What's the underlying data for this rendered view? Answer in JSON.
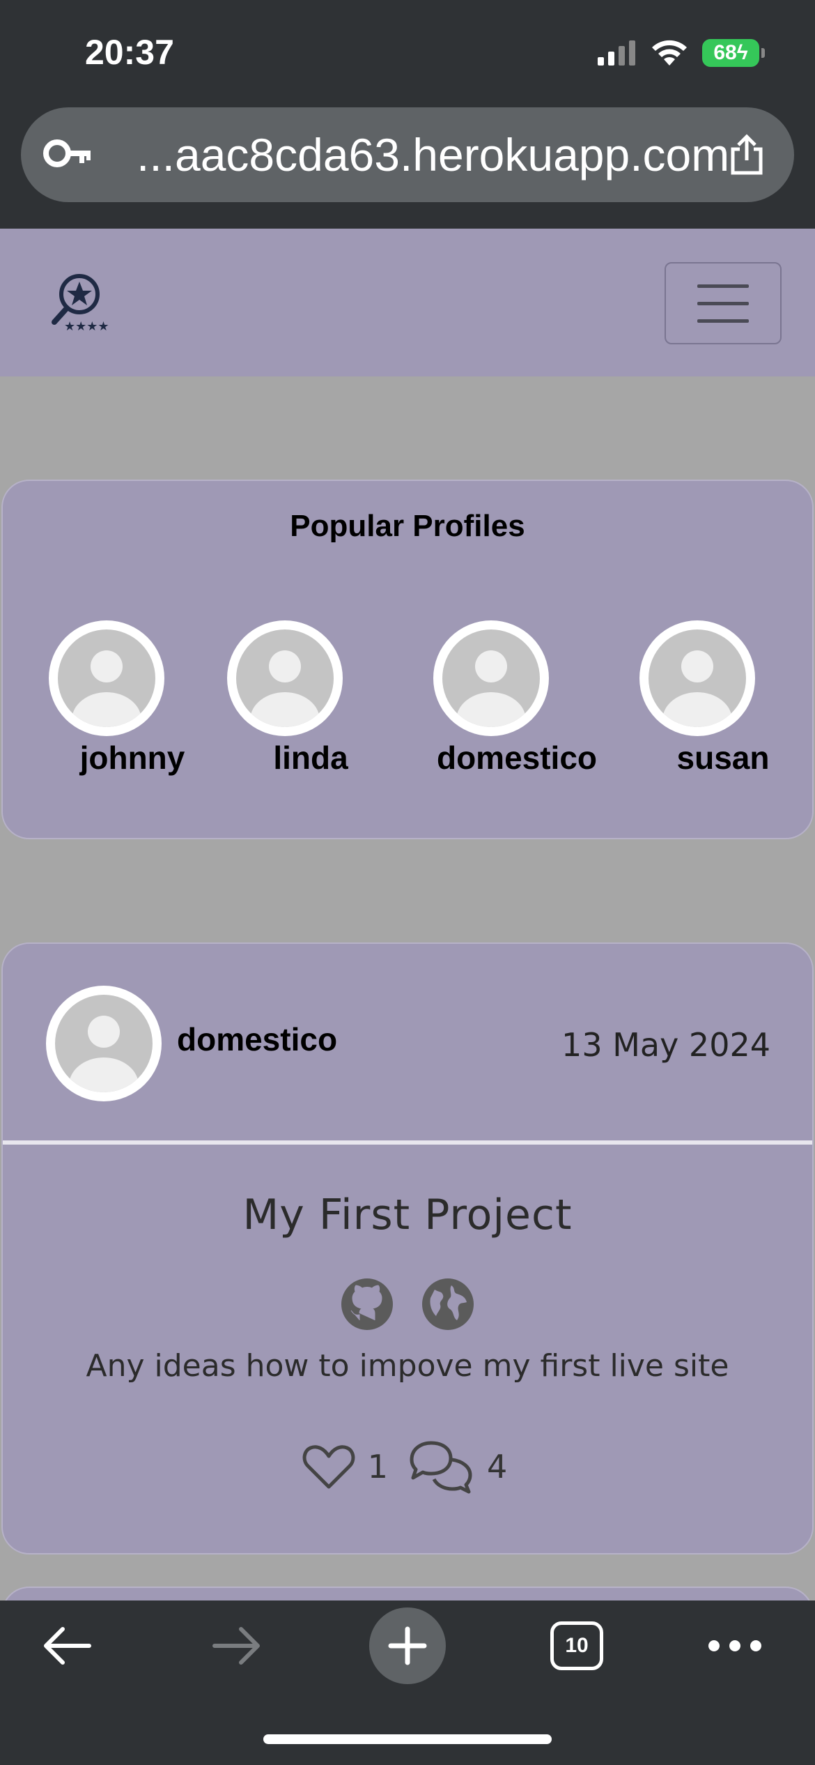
{
  "status_bar": {
    "time": "20:37",
    "battery": "68",
    "icons": [
      "signal-icon",
      "wifi-icon",
      "battery-charging-icon"
    ]
  },
  "browser": {
    "url": "...aac8cda63.herokuapp.com",
    "icons": [
      "key-icon",
      "share-icon"
    ]
  },
  "navbar": {
    "logo_icon": "magnifier-star-logo",
    "menu_icon": "hamburger-menu-icon"
  },
  "popular_profiles": {
    "title": "Popular Profiles",
    "profiles": [
      {
        "name": "johnny"
      },
      {
        "name": "linda"
      },
      {
        "name": "domestico"
      },
      {
        "name": "susan"
      }
    ]
  },
  "post": {
    "author": "domestico",
    "date": "13 May 2024",
    "title": "My First Project",
    "text": "Any ideas how to impove my first live site",
    "likes": "1",
    "comments": "4",
    "link_icons": [
      "github-icon",
      "globe-icon"
    ]
  },
  "toolbar": {
    "tab_count": "10",
    "icons": [
      "back-arrow-icon",
      "forward-arrow-icon",
      "plus-icon",
      "tabs-icon",
      "more-icon"
    ]
  },
  "colors": {
    "chrome": "#2f3235",
    "card": "#9f99b5",
    "page_background": "#a6a6a6",
    "battery": "#35c759"
  }
}
